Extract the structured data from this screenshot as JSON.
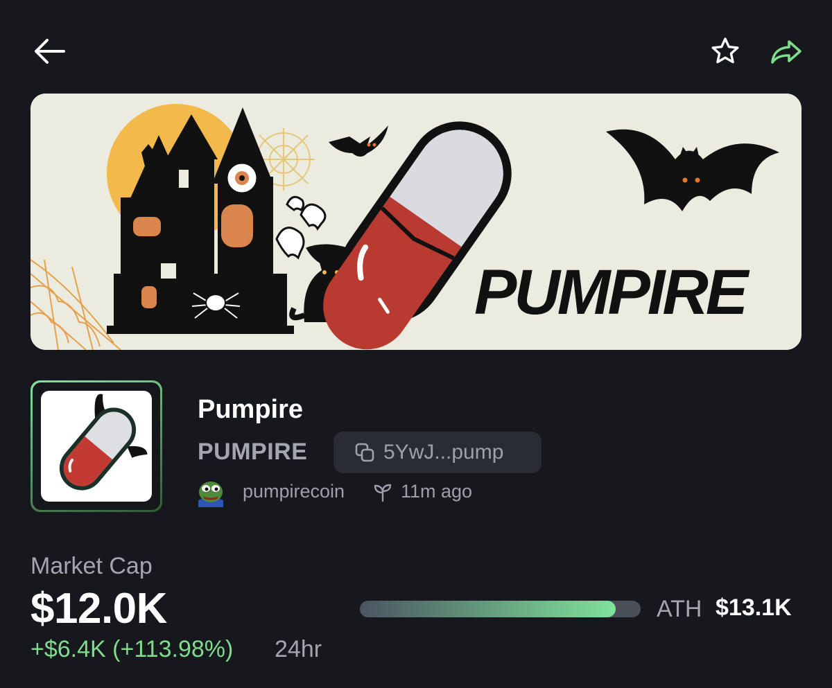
{
  "token": {
    "name": "Pumpire",
    "ticker": "PUMPIRE",
    "address_short": "5YwJ...pump"
  },
  "creator": {
    "username": "pumpirecoin",
    "age": "11m ago"
  },
  "banner": {
    "wordmark": "PUMPIRE"
  },
  "market": {
    "label": "Market Cap",
    "value": "$12.0K",
    "change": "+$6.4K (+113.98%)",
    "period": "24hr",
    "ath_label": "ATH",
    "ath_value": "$13.1K",
    "ath_progress": 0.91
  },
  "icons": {
    "back": "arrow-left-icon",
    "favorite": "star-icon",
    "share": "share-icon",
    "copy": "copy-icon",
    "age": "sprout-icon"
  },
  "colors": {
    "background": "#17181d",
    "accent_green": "#7fdc8e",
    "muted_text": "#a3a6b1",
    "chip_bg": "#2a2c33"
  }
}
